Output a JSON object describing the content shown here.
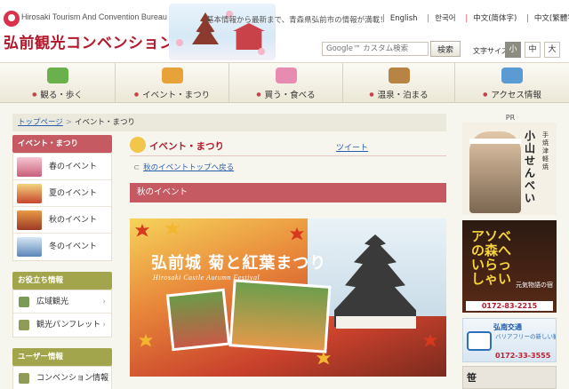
{
  "header": {
    "org_en": "Hirosaki Tourism And Convention Bureau",
    "org_ja": "弘前観光コンベンション協会",
    "tagline": "基本情報から最新まで、青森県弘前市の情報が満載！",
    "languages": [
      "English",
      "한국어",
      "中文(简体字)",
      "中文(繁體字)"
    ],
    "search": {
      "placeholder": "Google™ カスタム検索",
      "button": "検索"
    },
    "font_size": {
      "label": "文字サイズ",
      "small": "小",
      "medium": "中",
      "large": "大"
    }
  },
  "global_nav": [
    "観る・歩く",
    "イベント・まつり",
    "買う・食べる",
    "温泉・泊まる",
    "アクセス情報"
  ],
  "breadcrumb": {
    "home": "トップページ",
    "separator": ">",
    "current": "イベント・まつり"
  },
  "sidebar": {
    "events": {
      "title": "イベント・まつり",
      "items": [
        "春のイベント",
        "夏のイベント",
        "秋のイベント",
        "冬のイベント"
      ]
    },
    "useful": {
      "title": "お役立ち情報",
      "items": [
        "広域観光",
        "観光パンフレット"
      ]
    },
    "users": {
      "title": "ユーザー情報",
      "items": [
        "コンベンション情報"
      ]
    }
  },
  "main": {
    "title": "イベント・まつり",
    "tweet": "ツイート",
    "back_link": "秋のイベントトップへ戻る",
    "section_head": "秋のイベント",
    "banner": {
      "title": "弘前城 菊と紅葉まつり",
      "subtitle": "Hirosaki Castle Autumn Festival"
    }
  },
  "pr": {
    "label": "PR",
    "ad1": {
      "name": "小山せんべい",
      "sub": "手焼津軽焼"
    },
    "ad2": {
      "headline": "アソベの森へいらっしゃい",
      "caption": "元気物語の宿",
      "phone": "0172-83-2215"
    },
    "ad3": {
      "brand": "弘南交通",
      "copy": "バリアフリーの新しい観光バスで",
      "phone": "0172-33-3555"
    },
    "ad4": {
      "mark": "笹"
    }
  },
  "colors": {
    "brand_red": "#b3192b",
    "section_red": "#c55a63",
    "olive": "#a3a54c",
    "link_blue": "#2a5db0",
    "page_bg": "#f6f5ee"
  }
}
